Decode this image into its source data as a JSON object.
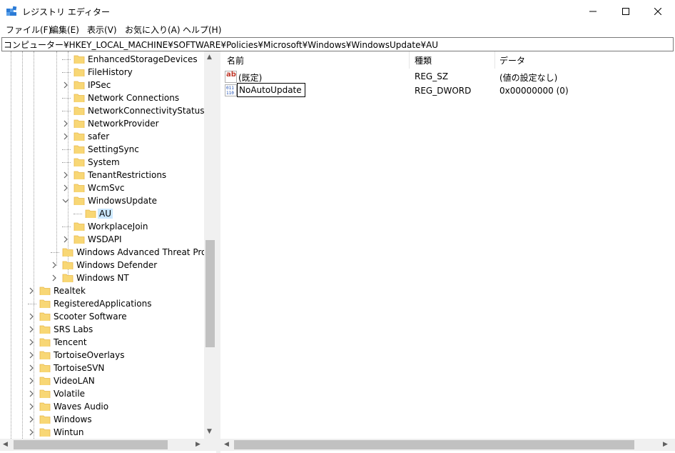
{
  "window": {
    "title": "レジストリ エディター",
    "minimize": "—",
    "maximize": "☐",
    "close": "✕"
  },
  "menu": [
    {
      "label": "ファイル(F)"
    },
    {
      "label": "編集(E)"
    },
    {
      "label": "表示(V)"
    },
    {
      "label": "お気に入り(A)"
    },
    {
      "label": "ヘルプ(H)"
    }
  ],
  "address": "コンピューター¥HKEY_LOCAL_MACHINE¥SOFTWARE¥Policies¥Microsoft¥Windows¥WindowsUpdate¥AU",
  "tree": [
    {
      "label": "EnhancedStorageDevices",
      "expander": "none",
      "level": 4
    },
    {
      "label": "FileHistory",
      "expander": "none",
      "level": 4
    },
    {
      "label": "IPSec",
      "expander": "collapsed",
      "level": 4
    },
    {
      "label": "Network Connections",
      "expander": "none",
      "level": 4
    },
    {
      "label": "NetworkConnectivityStatusI",
      "expander": "none",
      "level": 4
    },
    {
      "label": "NetworkProvider",
      "expander": "collapsed",
      "level": 4
    },
    {
      "label": "safer",
      "expander": "collapsed",
      "level": 4
    },
    {
      "label": "SettingSync",
      "expander": "none",
      "level": 4
    },
    {
      "label": "System",
      "expander": "none",
      "level": 4
    },
    {
      "label": "TenantRestrictions",
      "expander": "collapsed",
      "level": 4
    },
    {
      "label": "WcmSvc",
      "expander": "collapsed",
      "level": 4
    },
    {
      "label": "WindowsUpdate",
      "expander": "expanded",
      "level": 4
    },
    {
      "label": "AU",
      "expander": "none",
      "level": 5,
      "selected": true
    },
    {
      "label": "WorkplaceJoin",
      "expander": "none",
      "level": 4
    },
    {
      "label": "WSDAPI",
      "expander": "collapsed",
      "level": 4
    },
    {
      "label": "Windows Advanced Threat Pro",
      "expander": "none",
      "level": 3
    },
    {
      "label": "Windows Defender",
      "expander": "collapsed",
      "level": 3
    },
    {
      "label": "Windows NT",
      "expander": "collapsed",
      "level": 3
    },
    {
      "label": "Realtek",
      "expander": "collapsed",
      "level": 1
    },
    {
      "label": "RegisteredApplications",
      "expander": "none",
      "level": 1
    },
    {
      "label": "Scooter Software",
      "expander": "collapsed",
      "level": 1
    },
    {
      "label": "SRS Labs",
      "expander": "collapsed",
      "level": 1
    },
    {
      "label": "Tencent",
      "expander": "collapsed",
      "level": 1
    },
    {
      "label": "TortoiseOverlays",
      "expander": "collapsed",
      "level": 1
    },
    {
      "label": "TortoiseSVN",
      "expander": "collapsed",
      "level": 1
    },
    {
      "label": "VideoLAN",
      "expander": "collapsed",
      "level": 1
    },
    {
      "label": "Volatile",
      "expander": "collapsed",
      "level": 1
    },
    {
      "label": "Waves Audio",
      "expander": "collapsed",
      "level": 1
    },
    {
      "label": "Windows",
      "expander": "collapsed",
      "level": 1
    },
    {
      "label": "Wintun",
      "expander": "collapsed",
      "level": 1
    }
  ],
  "list": {
    "columns": [
      "名前",
      "種類",
      "データ"
    ],
    "rows": [
      {
        "icon": "string-value-icon",
        "icon_text": "ab",
        "name": "(既定)",
        "type": "REG_SZ",
        "data": "(値の設定なし)"
      },
      {
        "icon": "binary-value-icon",
        "icon_text": "011\n110",
        "name": "NoAutoUpdate",
        "type": "REG_DWORD",
        "data": "0x00000000 (0)",
        "editing": true
      }
    ]
  },
  "colors": {
    "folder": "#f8d775",
    "folder_dark": "#e8b84a",
    "selection": "#cce8ff",
    "scroll_thumb": "#c1c1c1"
  }
}
